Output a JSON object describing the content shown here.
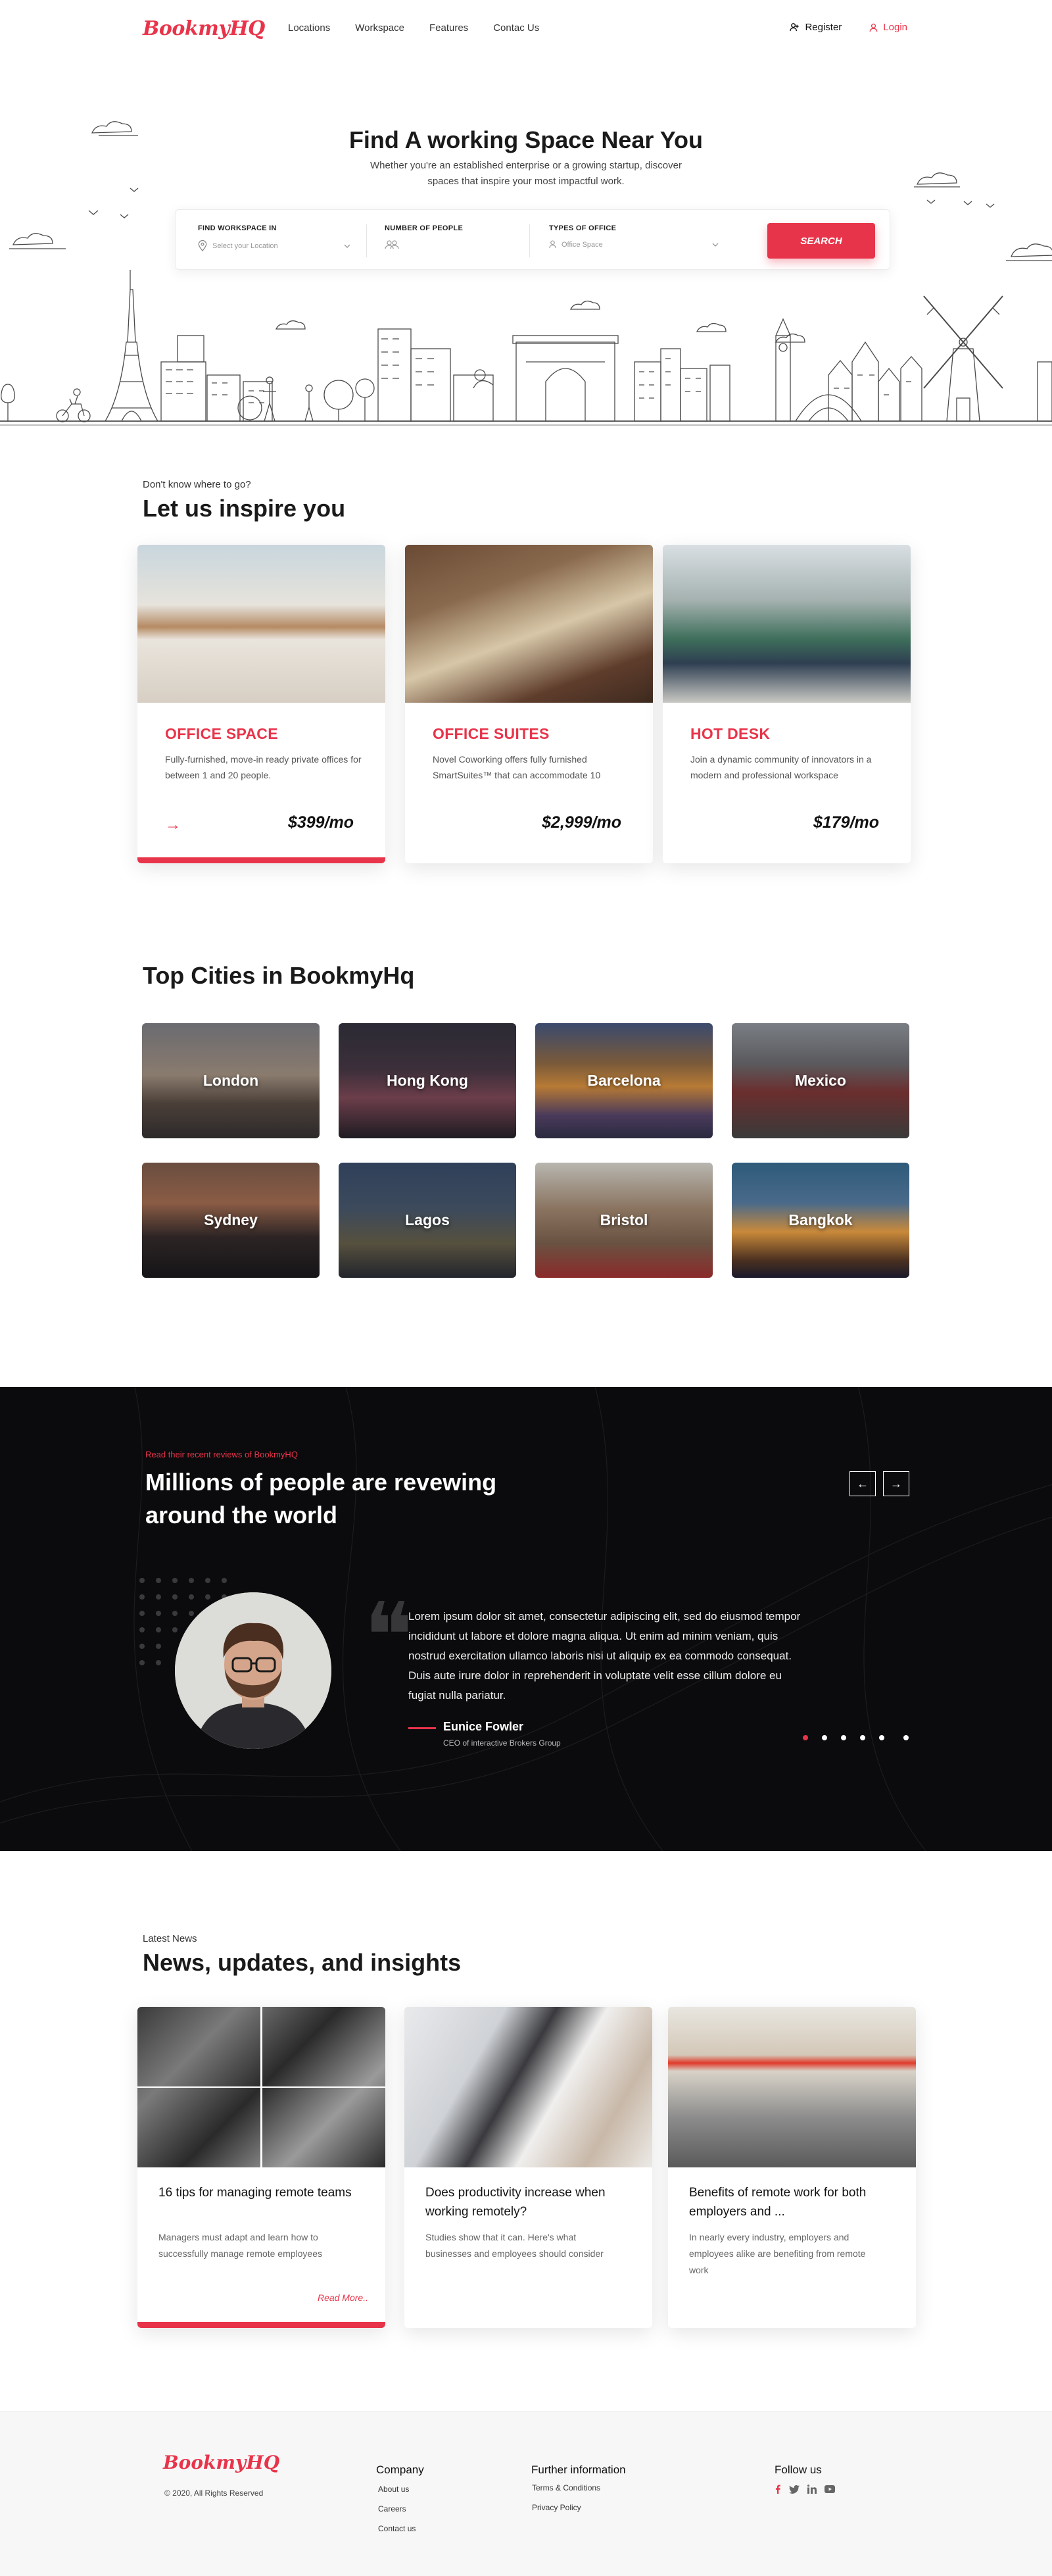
{
  "brand": {
    "logo": "BookmyHQ",
    "accent": "#e8344a"
  },
  "nav": {
    "links": [
      "Locations",
      "Workspace",
      "Features",
      "Contac Us"
    ],
    "register": "Register",
    "login": "Login"
  },
  "hero": {
    "title": "Find A working Space Near You",
    "subtitle": "Whether you're an established enterprise or a growing startup, discover spaces that inspire your most impactful work.",
    "search": {
      "workspace_label": "FIND WORKSPACE IN",
      "workspace_placeholder": "Select your Location",
      "people_label": "NUMBER OF PEOPLE",
      "office_label": "TYPES OF OFFICE",
      "office_value": "Office Space",
      "button": "SEARCH"
    }
  },
  "inspire": {
    "kicker": "Don't know where to go?",
    "title": "Let us inspire you",
    "cards": [
      {
        "title": "OFFICE SPACE",
        "desc": "Fully-furnished, move-in ready private offices for between 1 and 20 people.",
        "price": "$399/mo"
      },
      {
        "title": "OFFICE SUITES",
        "desc": "Novel Coworking offers fully furnished SmartSuites™ that can accommodate 10",
        "price": "$2,999/mo"
      },
      {
        "title": "HOT DESK",
        "desc": "Join a dynamic community of innovators in a modern and professional workspace",
        "price": "$179/mo"
      }
    ]
  },
  "cities": {
    "title": "Top Cities in BookmyHq",
    "items": [
      "London",
      "Hong Kong",
      "Barcelona",
      "Mexico",
      "Sydney",
      "Lagos",
      "Bristol",
      "Bangkok"
    ]
  },
  "testimonials": {
    "kicker": "Read their recent reviews of BookmyHQ",
    "title": "Millions of people are revewing around the world",
    "quote": "Lorem ipsum dolor sit amet, consectetur adipiscing elit, sed do eiusmod tempor incididunt ut labore et dolore magna aliqua. Ut enim ad minim veniam, quis nostrud exercitation ullamco laboris nisi ut aliquip ex ea commodo consequat. Duis aute irure dolor in reprehenderit in voluptate velit esse cillum dolore eu fugiat nulla pariatur.",
    "name": "Eunice Fowler",
    "role": "CEO of interactive Brokers Group",
    "slide_count": 6,
    "active_slide": 1
  },
  "news": {
    "kicker": "Latest News",
    "title": "News, updates, and insights",
    "cards": [
      {
        "title": "16 tips for managing remote teams",
        "desc": "Managers must adapt and learn how to successfully manage remote employees",
        "more": "Read More.."
      },
      {
        "title": "Does productivity increase when working remotely?",
        "desc": "Studies show that it can. Here's what businesses and employees should consider"
      },
      {
        "title": "Benefits of remote work for both employers and ...",
        "desc": "In nearly every industry, employers and employees alike are benefiting from remote work"
      }
    ]
  },
  "footer": {
    "logo": "BookmyHQ",
    "copyright": "© 2020, All Rights Reserved",
    "company": {
      "heading": "Company",
      "links": [
        "About us",
        "Careers",
        "Contact us"
      ]
    },
    "further": {
      "heading": "Further information",
      "links": [
        "Terms & Conditions",
        "Privacy Policy"
      ]
    },
    "follow": {
      "heading": "Follow us",
      "icons": [
        "facebook-icon",
        "twitter-icon",
        "linkedin-icon",
        "youtube-icon"
      ]
    }
  }
}
